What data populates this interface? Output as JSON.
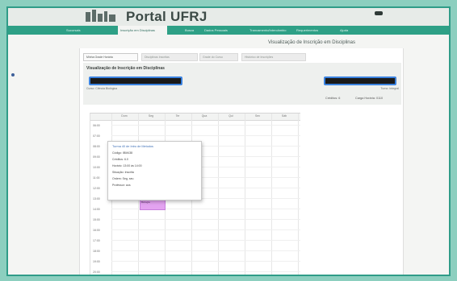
{
  "header": {
    "brand": "Portal UFRJ",
    "nav": [
      {
        "label": "Sucursais",
        "active": false
      },
      {
        "label": "Inscrição em Disciplinas",
        "active": true
      },
      {
        "label": "Busca",
        "active": false
      },
      {
        "label": "Dados Pessoais",
        "active": false
      },
      {
        "label": "Trancamento/Intercâmbio",
        "active": false
      },
      {
        "label": "Requerimentos",
        "active": false
      },
      {
        "label": "Ajuda",
        "active": false
      }
    ]
  },
  "page": {
    "heading": "Visualização de Inscrição em Disciplinas"
  },
  "subtabs": [
    {
      "label": "Minha Grade Horária",
      "active": true
    },
    {
      "label": "Disciplinas Inscritas",
      "active": false
    },
    {
      "label": "Grade do Curso",
      "active": false
    },
    {
      "label": "Histórico de Inscrições",
      "active": false
    }
  ],
  "info": {
    "title": "Visualização de Inscrição em Disciplinas",
    "side_mark": "1",
    "sub_left": "Curso: Ciência Biológica",
    "sub_right": "Turno: Integral",
    "meta_a": "Créditos: 6",
    "meta_b": "Carga Horária: 0110"
  },
  "calendar": {
    "days": [
      "Dom",
      "Seg",
      "Ter",
      "Qua",
      "Qui",
      "Sex",
      "Sáb"
    ],
    "times": [
      "06:00",
      "07:00",
      "08:00",
      "09:00",
      "10:00",
      "11:00",
      "12:00",
      "13:00",
      "14:00",
      "15:00",
      "16:00",
      "17:00",
      "18:00",
      "19:00",
      "20:00"
    ],
    "event": {
      "label": "Biologia",
      "day": "Seg",
      "start": "13:00",
      "end": "14:00"
    }
  },
  "tooltip": {
    "title": "Turma 40 de Intro de Metodos",
    "lines": [
      "Código: IBM438",
      "Créditos: 6.0",
      "Horário: 13:00 às 14:00",
      "Situação: Inscrita",
      "Ordem: Seg, seu",
      "Professor: aos"
    ]
  }
}
